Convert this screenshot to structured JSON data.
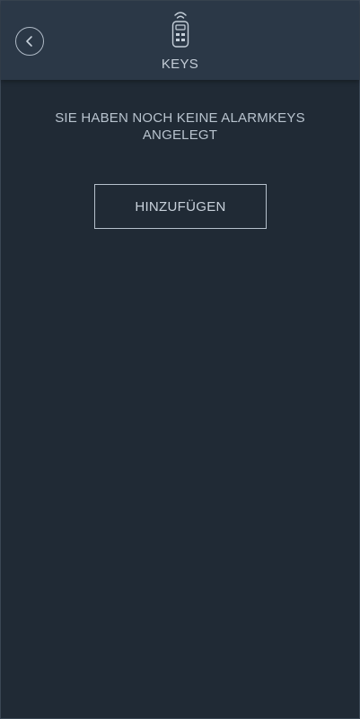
{
  "header": {
    "title": "KEYS",
    "back_icon": "chevron-left-icon",
    "title_icon": "remote-key-icon"
  },
  "main": {
    "empty_message": "SIE HABEN NOCH KEINE ALARMKEYS ANGELEGT",
    "add_button_label": "HINZUFÜGEN"
  },
  "colors": {
    "background": "#202a35",
    "header_background": "#2b3847",
    "text": "#c9d2dc",
    "border": "#b6c1cc"
  }
}
